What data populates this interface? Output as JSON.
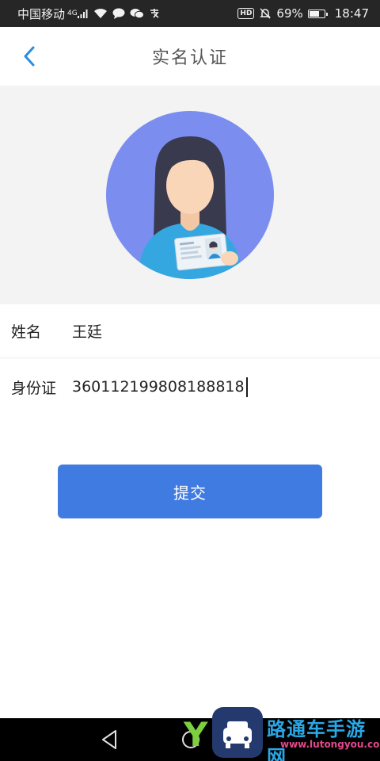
{
  "status_bar": {
    "carrier": "中国移动",
    "network": "4G",
    "battery_percent": "69%",
    "battery_level": 0.69,
    "time": "18:47",
    "hd_label": "HD",
    "icons": [
      "signal-icon",
      "wifi-icon",
      "message-icon",
      "wechat-icon",
      "alipay-icon",
      "hd-icon",
      "mute-bell-icon",
      "battery-icon"
    ]
  },
  "header": {
    "title": "实名认证",
    "back_icon": "chevron-left-icon"
  },
  "avatar": {
    "icon": "id-card-person-illustration",
    "circle_color": "#7b8ef0",
    "shirt_color": "#35a7e0"
  },
  "form": {
    "name_label": "姓名",
    "name_value": "王廷",
    "id_label": "身份证",
    "id_value": "360112199808188818"
  },
  "actions": {
    "submit_label": "提交"
  },
  "colors": {
    "accent": "#3f7be0",
    "back_icon": "#2b8ce0",
    "page_bg": "#f3f3f3"
  },
  "watermark": {
    "brand_text": "路通车手游网",
    "url": "www.lutongyou.com"
  }
}
